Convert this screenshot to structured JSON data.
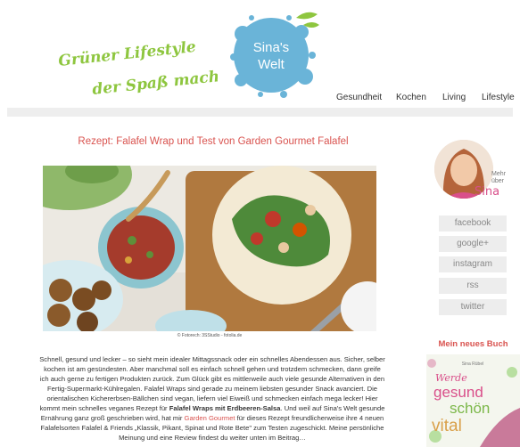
{
  "header": {
    "slogan_line1": "Grüner Lifestyle",
    "slogan_line2": "der Spaß macht!",
    "logo_line1": "Sina's",
    "logo_line2": "Welt"
  },
  "nav": {
    "items": [
      "Gesundheit",
      "Kochen",
      "Living",
      "Lifestyle"
    ]
  },
  "post": {
    "title": "Rezept: Falafel Wrap und Test von Garden Gourmet Falafel",
    "image_caption": "© Fotorech: 3SStudio - fotolia.de",
    "body_1": "Schnell, gesund und lecker – so sieht mein idealer Mittagssnack oder ein schnelles Abendessen aus. Sicher, selber kochen ist am gesündesten. Aber manchmal soll es einfach schnell gehen und trotzdem schmecken, dann greife ich auch gerne zu fertigen Produkten zurück. Zum Glück gibt es mittlerweile auch viele gesunde Alternativen in den Fertig-Supermarkt-Kühlregalen. Falafel Wraps sind gerade zu meinem liebsten gesunder Snack avanciert. Die orientalischen Kichererbsen-Bällchen sind vegan, liefern viel Eiweiß und schmecken einfach mega lecker! Hier kommt mein schnelles veganes Rezept für ",
    "body_bold": "Falafel Wraps mit Erdbeeren-Salsa",
    "body_2": ". Und weil auf Sina's Welt gesunde Ernährung ganz groß geschrieben wird, hat mir ",
    "body_link": "Garden Gourmet",
    "body_3": " für dieses Rezept freundlicherweise ihre 4 neuen Falafelsorten Falafel & Friends „Klassik, Pikant, Spinat und Rote Bete\" zum Testen zugeschickt. Meine persönliche Meinung und eine Review findest du weiter unten im Beitrag…"
  },
  "sidebar": {
    "mehr_line1": "Mehr",
    "mehr_line2": "über",
    "sina_label": "Sina",
    "social": [
      "facebook",
      "google+",
      "instagram",
      "rss",
      "twitter"
    ],
    "book_heading": "Mein neues Buch",
    "book_author": "Sina Rübel",
    "book_title_1": "Werde",
    "book_title_2": "gesund",
    "book_title_3": "schön",
    "book_title_4": "vital"
  },
  "colors": {
    "accent_red": "#d9534f",
    "slogan_green": "#8ec63f",
    "logo_blue": "#6ab4d8",
    "sina_pink": "#d94f8a"
  }
}
